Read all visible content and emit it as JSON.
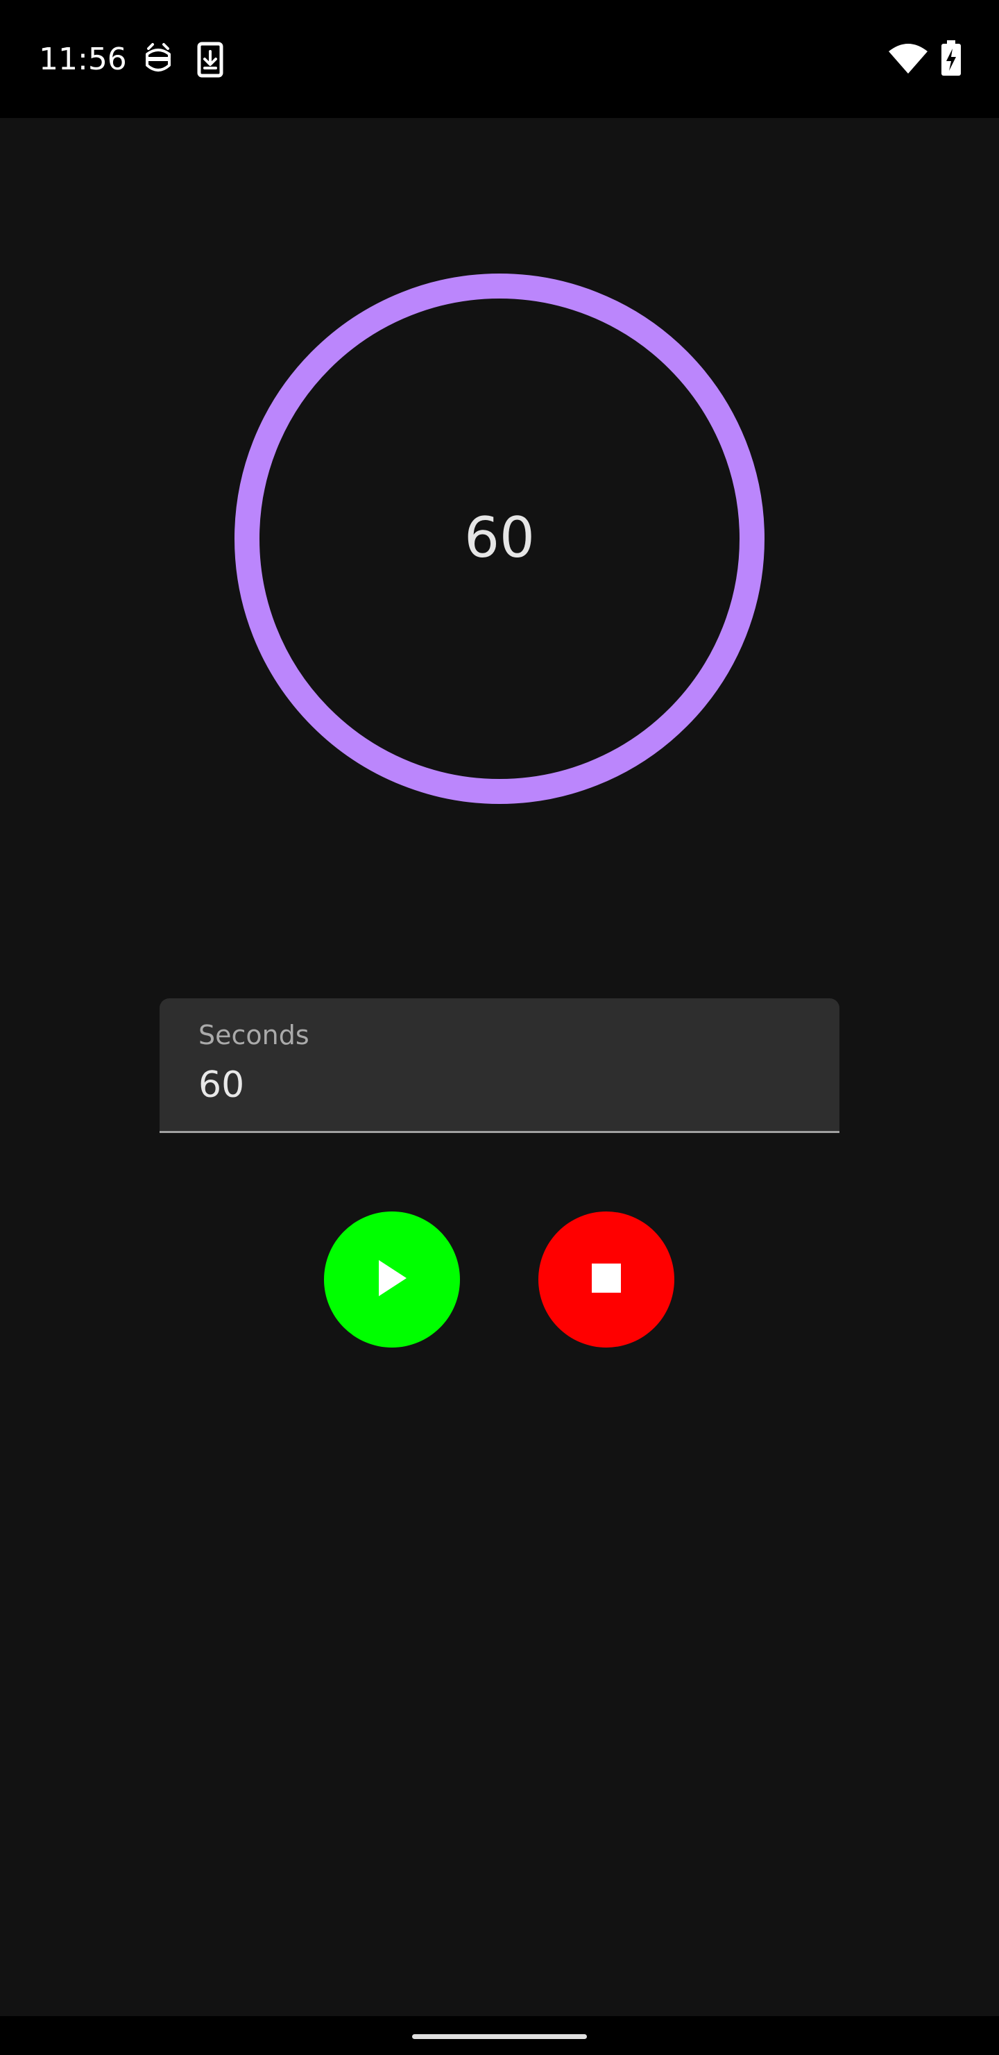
{
  "status_bar": {
    "time": "11:56",
    "left_icons": [
      "android-debug-icon",
      "download-notification-icon"
    ],
    "right_icons": [
      "wifi-icon",
      "battery-charging-icon"
    ]
  },
  "timer": {
    "display_value": "60",
    "ring_color": "#BB86FC"
  },
  "seconds_field": {
    "label": "Seconds",
    "value": "60"
  },
  "controls": {
    "play": {
      "icon": "play-icon",
      "color": "#00FF00"
    },
    "stop": {
      "icon": "stop-icon",
      "color": "#FF0000"
    }
  },
  "colors": {
    "background": "#121212",
    "system_bars": "#000000"
  }
}
